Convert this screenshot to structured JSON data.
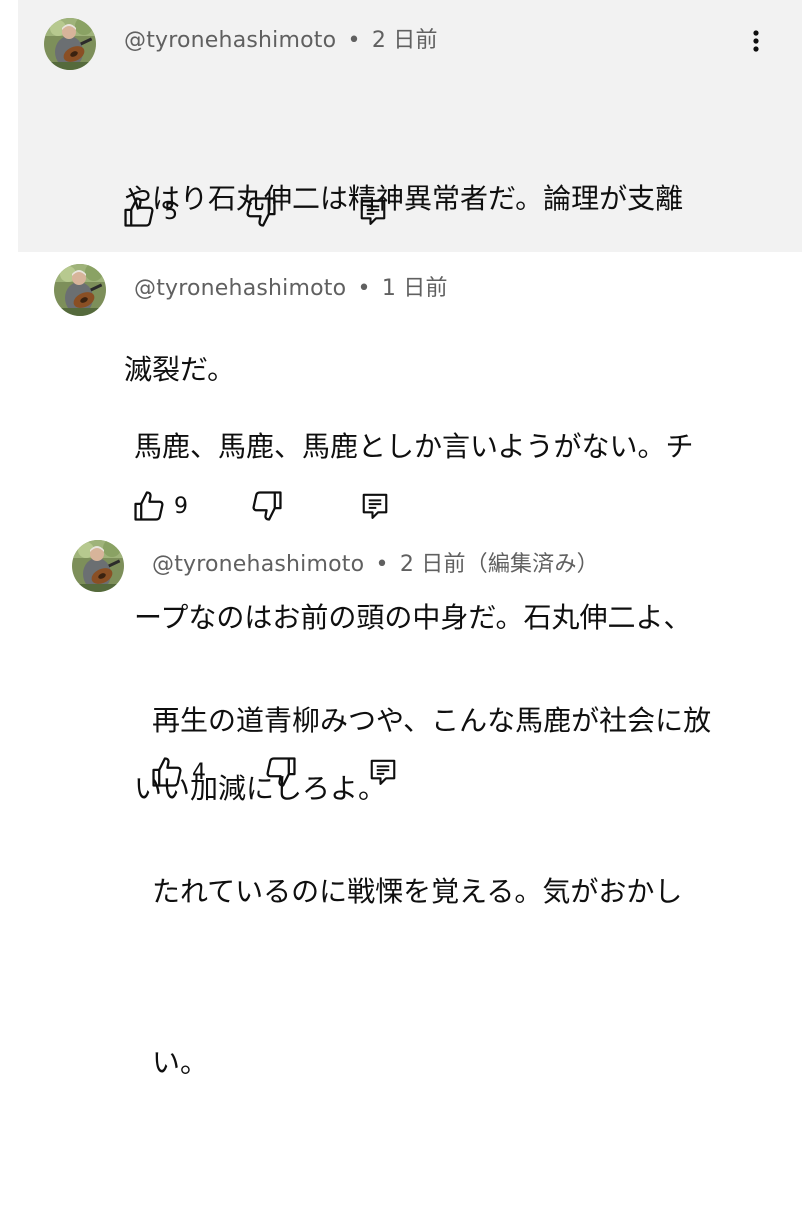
{
  "comments": [
    {
      "author": "@tyronehashimoto",
      "separator": "•",
      "time": "2 日前",
      "lines": [
        "やはり石丸伸二は精神異常者だ。論理が支離",
        "滅裂だ。"
      ],
      "likes": "5",
      "highlighted": true
    },
    {
      "author": "@tyronehashimoto",
      "separator": "•",
      "time": "1 日前",
      "lines": [
        "馬鹿、馬鹿、馬鹿としか言いようがない。チ",
        "ープなのはお前の頭の中身だ。石丸伸二よ、",
        "いい加減にしろよ。"
      ],
      "likes": "9"
    },
    {
      "author": "@tyronehashimoto",
      "separator": "•",
      "time": "2 日前（編集済み）",
      "lines": [
        "再生の道青柳みつや、こんな馬鹿が社会に放",
        "たれているのに戦慄を覚える。気がおかし",
        "い。"
      ],
      "likes": "4"
    }
  ],
  "icons": {
    "like": "thumbs-up-icon",
    "dislike": "thumbs-down-icon",
    "reply": "reply-comment-icon",
    "more": "more-vertical-icon"
  },
  "colors": {
    "highlight_bg": "#f2f2f2",
    "meta_text": "#606060",
    "body_text": "#0f0f0f"
  }
}
